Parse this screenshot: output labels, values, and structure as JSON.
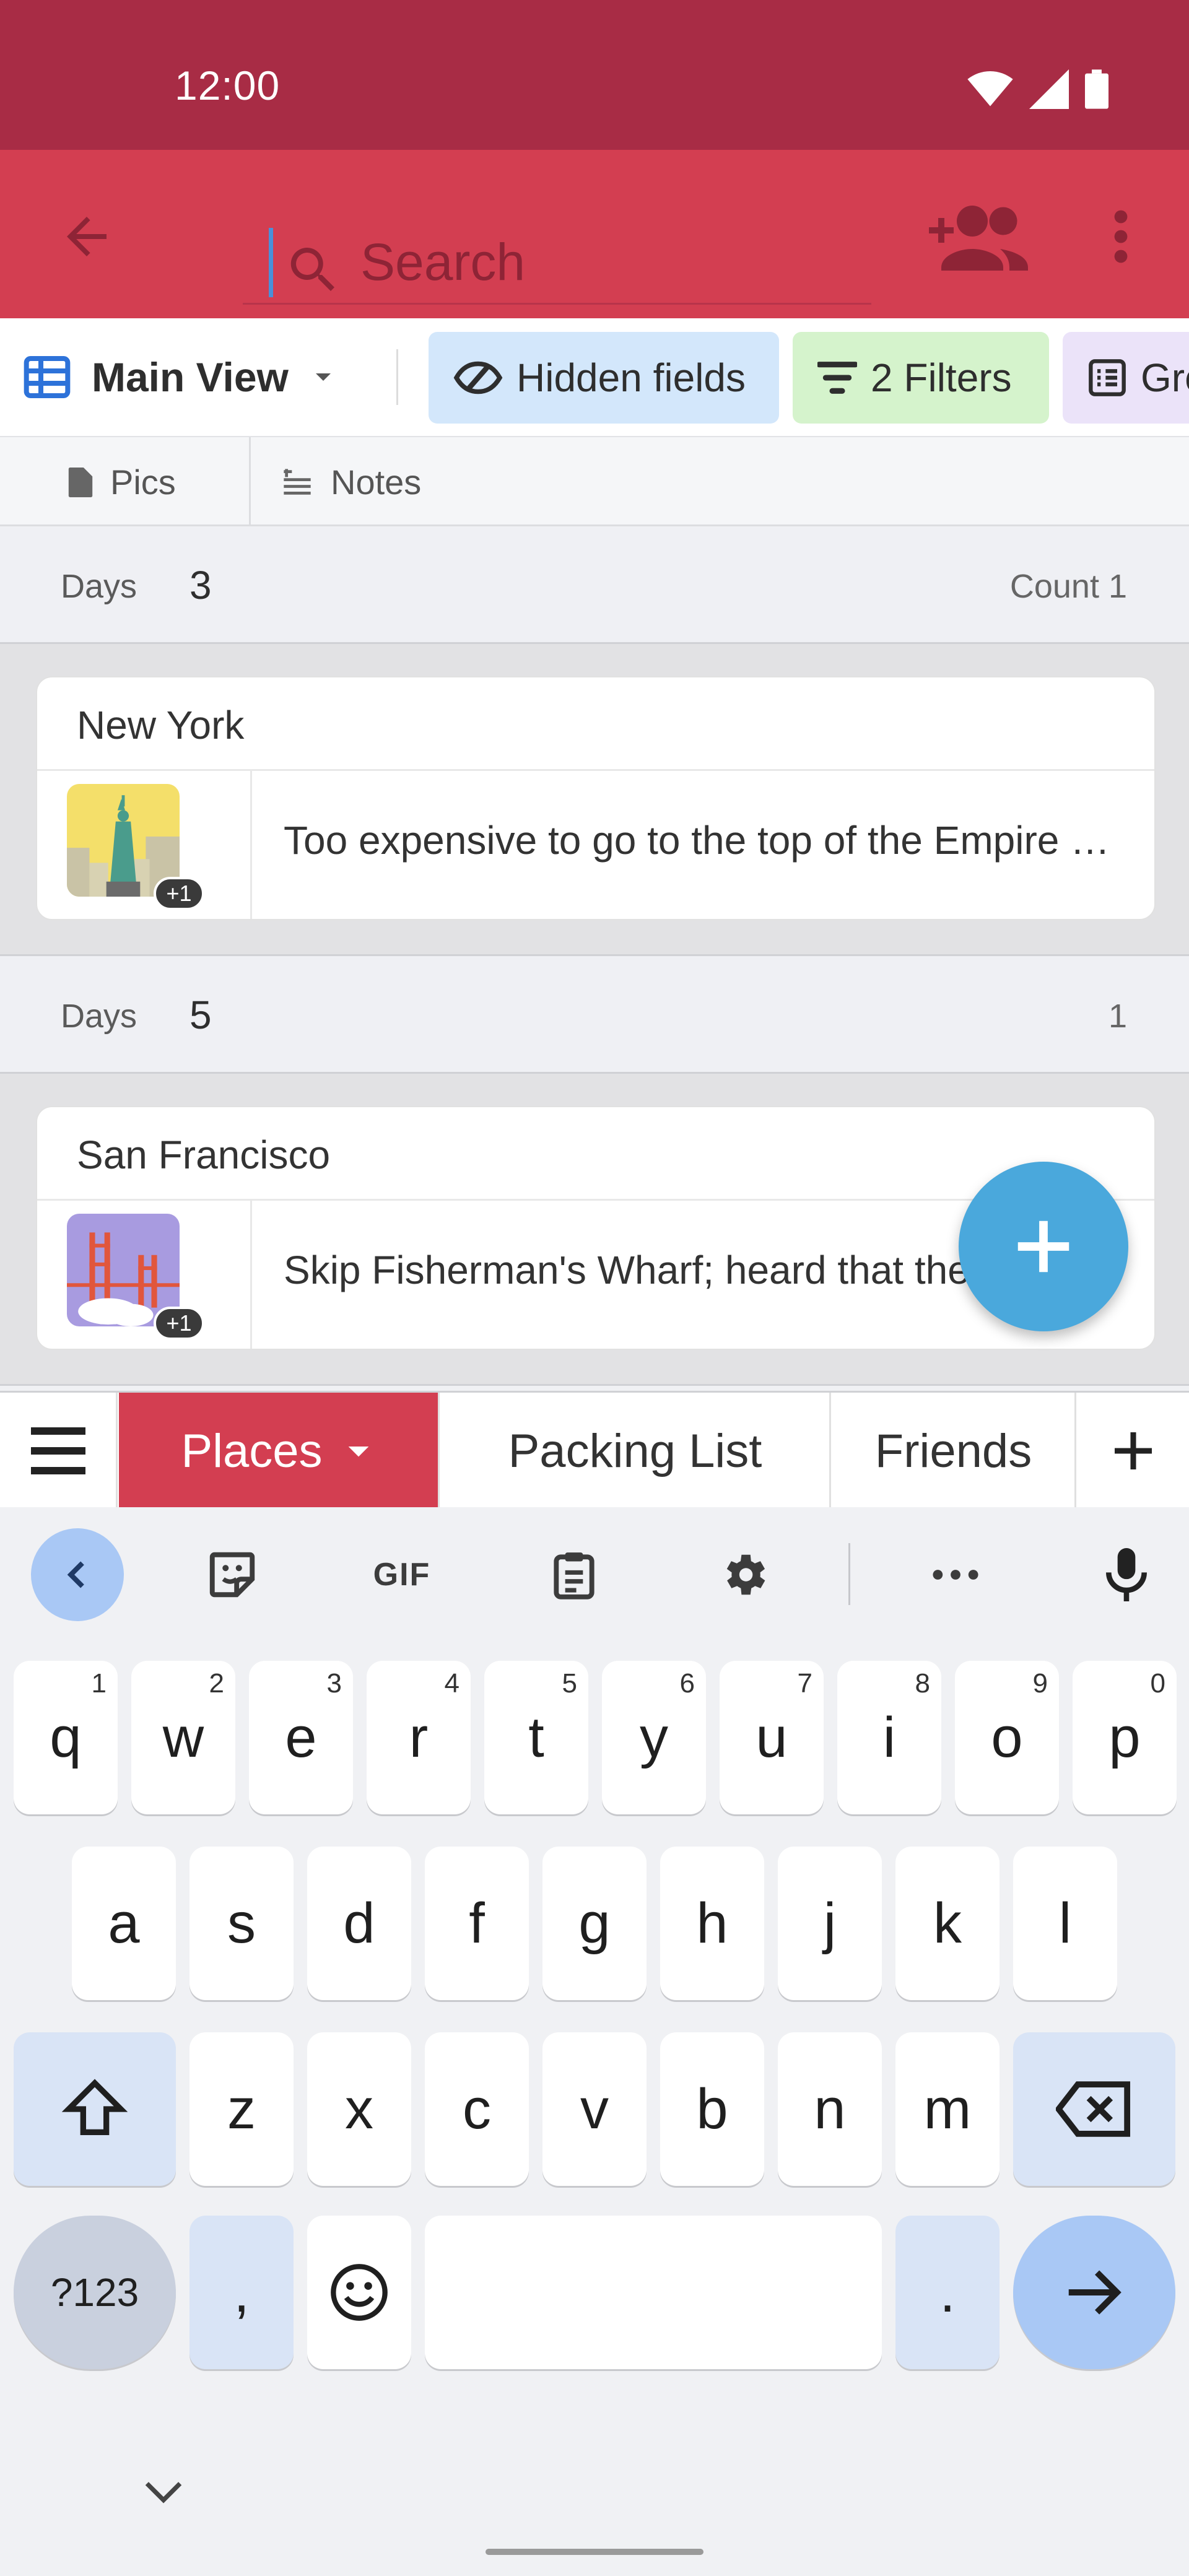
{
  "status_bar": {
    "time": "12:00",
    "icons": [
      "wifi-icon",
      "signal-icon",
      "battery-icon"
    ]
  },
  "app_bar": {
    "search_placeholder": "Search",
    "icons": [
      "back-arrow-icon",
      "search-icon",
      "add-person-icon",
      "more-vert-icon"
    ]
  },
  "view_toolbar": {
    "view_name": "Main View",
    "chips": {
      "hidden_fields": "Hidden fields",
      "filters": "2 Filters",
      "group": "Group"
    }
  },
  "columns": {
    "pics": "Pics",
    "notes": "Notes"
  },
  "groups": [
    {
      "label": "Days",
      "value": "3",
      "count": "Count 1",
      "record": {
        "title": "New York",
        "thumb_badge": "+1",
        "note": "Too expensive to go to the top of the Empire State Building"
      }
    },
    {
      "label": "Days",
      "value": "5",
      "count": "1",
      "record": {
        "title": "San Francisco",
        "thumb_badge": "+1",
        "note": "Skip Fisherman's Wharf; heard that the"
      }
    }
  ],
  "tabs": {
    "places": "Places",
    "packing_list": "Packing List",
    "friends": "Friends"
  },
  "keyboard": {
    "toolbar": {
      "gif": "GIF"
    },
    "row1": [
      {
        "k": "q",
        "h": "1"
      },
      {
        "k": "w",
        "h": "2"
      },
      {
        "k": "e",
        "h": "3"
      },
      {
        "k": "r",
        "h": "4"
      },
      {
        "k": "t",
        "h": "5"
      },
      {
        "k": "y",
        "h": "6"
      },
      {
        "k": "u",
        "h": "7"
      },
      {
        "k": "i",
        "h": "8"
      },
      {
        "k": "o",
        "h": "9"
      },
      {
        "k": "p",
        "h": "0"
      }
    ],
    "row2": [
      "a",
      "s",
      "d",
      "f",
      "g",
      "h",
      "j",
      "k",
      "l"
    ],
    "row3": [
      "z",
      "x",
      "c",
      "v",
      "b",
      "n",
      "m"
    ],
    "row4": {
      "symbols": "?123",
      "comma": ",",
      "period": "."
    }
  },
  "colors": {
    "status_bar": "#a82c45",
    "app_bar": "#d33e51",
    "active_tab": "#d33e51",
    "fab": "#4aa8dc",
    "chip_hidden": "#d3e7fb",
    "chip_filters": "#d5f3cc",
    "chip_group": "#ebe3f9"
  }
}
